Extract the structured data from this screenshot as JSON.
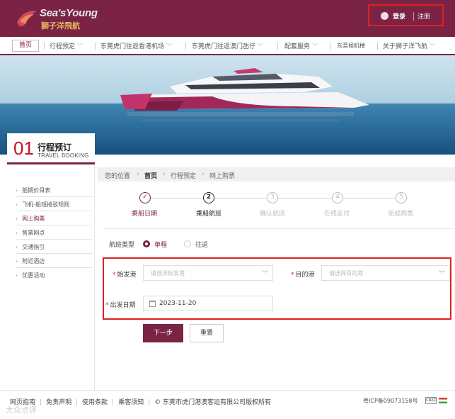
{
  "brand": {
    "logo_en": "Sea'sYoung",
    "logo_cn": "獅子洋飛航",
    "accent": "#7a2345"
  },
  "header": {
    "login": "登录",
    "register": "注册",
    "login_icon": "user-icon"
  },
  "nav": {
    "items": [
      {
        "label": "首页"
      },
      {
        "label": "行程预定"
      },
      {
        "label": "东莞虎门往返香港机场"
      },
      {
        "label": "东莞虎门往返澳门氹仔"
      },
      {
        "label": "配套服务"
      },
      {
        "label": "东莞候机楼"
      },
      {
        "label": "关于狮子洋飞航"
      }
    ]
  },
  "booking": {
    "number": "01",
    "title": "行程预订",
    "subtitle": "TRAVEL BOOKING"
  },
  "sidebar": {
    "items": [
      {
        "label": "船期价目表"
      },
      {
        "label": "飞机-船班接驳规则"
      },
      {
        "label": "网上购票"
      },
      {
        "label": "售票网点"
      },
      {
        "label": "交通指引"
      },
      {
        "label": "附近酒店"
      },
      {
        "label": "优惠活动"
      }
    ]
  },
  "breadcrumb": {
    "prefix": "您的位置",
    "items": [
      {
        "label": "首页"
      },
      {
        "label": "行程预定"
      },
      {
        "label": "网上购票"
      }
    ]
  },
  "steps": [
    {
      "icon": "✓",
      "label": "乘船日期",
      "state": "done"
    },
    {
      "icon": "2",
      "label": "乘船航班",
      "state": "current"
    },
    {
      "icon": "3",
      "label": "确认航班",
      "state": "todo"
    },
    {
      "icon": "4",
      "label": "在线支付",
      "state": "todo"
    },
    {
      "icon": "5",
      "label": "完成购票",
      "state": "todo"
    }
  ],
  "trip_type": {
    "label": "航班类型",
    "options": [
      {
        "label": "单程",
        "checked": true
      },
      {
        "label": "往返",
        "checked": false
      }
    ]
  },
  "form": {
    "origin_label": "始发港",
    "origin_placeholder": "请选择始发港",
    "dest_label": "目的港",
    "dest_placeholder": "请选择目的港",
    "date_label": "出发日期",
    "date_value": "2023-11-20",
    "required_mark": "*"
  },
  "buttons": {
    "next": "下一步",
    "reset": "重置"
  },
  "footer": {
    "links": [
      "网页指南",
      "免责声明",
      "使用条款",
      "乘客须知"
    ],
    "copyright": "© 东莞市虎门港澳客运有限公司版权所有",
    "icp": "粤ICP备09073158号",
    "badge": "CNZZ"
  },
  "watermark": "大众点评"
}
